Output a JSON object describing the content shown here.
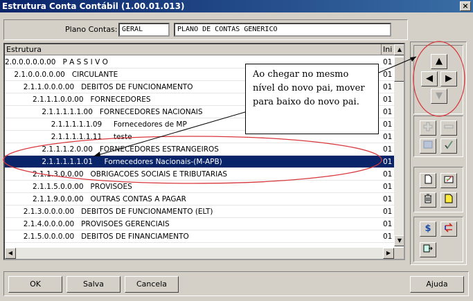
{
  "window": {
    "title": "Estrutura Conta Contábil (1.00.01.013)",
    "close_glyph": "×"
  },
  "plano": {
    "label": "Plano Contas:",
    "code": "GERAL",
    "description": "PLANO DE CONTAS GENERICO"
  },
  "grid": {
    "headers": [
      "Estrutura",
      "Ini"
    ],
    "rows": [
      {
        "text": "2.0.0.0.0.0.00   P A S S I V O",
        "ini": "01"
      },
      {
        "text": "    2.1.0.0.0.0.00   CIRCULANTE",
        "ini": "01"
      },
      {
        "text": "        2.1.1.0.0.0.00   DEBITOS DE FUNCIONAMENTO",
        "ini": "01"
      },
      {
        "text": "            2.1.1.1.0.0.00   FORNECEDORES",
        "ini": "01"
      },
      {
        "text": "                2.1.1.1.1.1.00   FORNECEDORES NACIONAIS",
        "ini": "01"
      },
      {
        "text": "                    2.1.1.1.1.1.09     Fornecedores de MP",
        "ini": "01"
      },
      {
        "text": "                    2.1.1.1.1.1.11     teste",
        "ini": "01"
      },
      {
        "text": "                2.1.1.1.2.0.00   FORNECEDORES ESTRANGEIROS",
        "ini": "01"
      },
      {
        "text": "                2.1.1.1.1.1.01     Fornecedores Nacionais-(M-APB)",
        "ini": "01"
      },
      {
        "text": "            2.1.1.3.0.0.00   OBRIGACOES SOCIAIS E TRIBUTARIAS",
        "ini": "01"
      },
      {
        "text": "            2.1.1.5.0.0.00   PROVISOES",
        "ini": "01"
      },
      {
        "text": "            2.1.1.9.0.0.00   OUTRAS CONTAS A PAGAR",
        "ini": "01"
      },
      {
        "text": "        2.1.3.0.0.0.00   DEBITOS DE FUNCIONAMENTO (ELT)",
        "ini": "01"
      },
      {
        "text": "        2.1.4.0.0.0.00   PROVISOES GERENCIAIS",
        "ini": "01"
      },
      {
        "text": "        2.1.5.0.0.0.00   DEBITOS DE FINANCIAMENTO",
        "ini": "01"
      }
    ],
    "selected_index": 8
  },
  "callout": {
    "text": "Ao chegar no mesmo nível do novo pai, mover para baixo do novo pai."
  },
  "tools": {
    "move_up": "▲",
    "move_left": "◀",
    "move_right": "▶",
    "move_down": "▼",
    "scroll_up": "▲",
    "scroll_down": "▼",
    "scroll_left": "◀",
    "scroll_right": "▶"
  },
  "buttons": {
    "ok": "OK",
    "salva": "Salva",
    "cancela": "Cancela",
    "ajuda": "Ajuda"
  },
  "colors": {
    "selection": "#0a246a",
    "annotation": "#d8373c",
    "titlebar": "#0a246a"
  }
}
